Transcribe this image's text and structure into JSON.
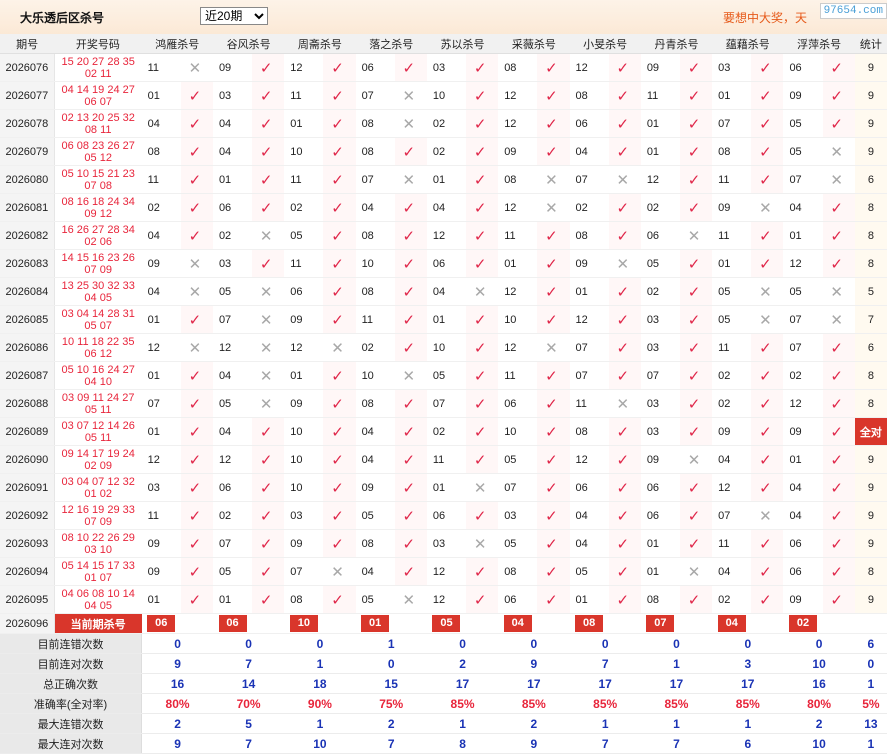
{
  "header": {
    "title": "大乐透后区杀号",
    "period_option": "近20期",
    "marquee": "要想中大奖，天",
    "logo": "97654.com"
  },
  "columns": {
    "period": "期号",
    "numbers": "开奖号码",
    "experts": [
      "鸿雁杀号",
      "谷风杀号",
      "周斋杀号",
      "落之杀号",
      "苏以杀号",
      "采薇杀号",
      "小旻杀号",
      "丹青杀号",
      "蕴藉杀号",
      "浮萍杀号"
    ],
    "stat": "统计"
  },
  "marks": {
    "ok": "✓",
    "err": "✕"
  },
  "rows": [
    {
      "qi": "2026076",
      "front": "15 20 27 28 35",
      "back": "02 11",
      "picks": [
        "11",
        "09",
        "12",
        "06",
        "03",
        "08",
        "12",
        "09",
        "03",
        "06"
      ],
      "res": [
        0,
        1,
        1,
        1,
        1,
        1,
        1,
        1,
        1,
        1
      ],
      "stat": "9"
    },
    {
      "qi": "2026077",
      "front": "04 14 19 24 27",
      "back": "06 07",
      "picks": [
        "01",
        "03",
        "11",
        "07",
        "10",
        "12",
        "08",
        "11",
        "01",
        "09"
      ],
      "res": [
        1,
        1,
        1,
        0,
        1,
        1,
        1,
        1,
        1,
        1
      ],
      "stat": "9"
    },
    {
      "qi": "2026078",
      "front": "02 13 20 25 32",
      "back": "08 11",
      "picks": [
        "04",
        "04",
        "01",
        "08",
        "02",
        "12",
        "06",
        "01",
        "07",
        "05"
      ],
      "res": [
        1,
        1,
        1,
        0,
        1,
        1,
        1,
        1,
        1,
        1
      ],
      "stat": "9"
    },
    {
      "qi": "2026079",
      "front": "06 08 23 26 27",
      "back": "05 12",
      "picks": [
        "08",
        "04",
        "10",
        "08",
        "02",
        "09",
        "04",
        "01",
        "08",
        "05"
      ],
      "res": [
        1,
        1,
        1,
        1,
        1,
        1,
        1,
        1,
        1,
        0
      ],
      "stat": "9"
    },
    {
      "qi": "2026080",
      "front": "05 10 15 21 23",
      "back": "07 08",
      "picks": [
        "11",
        "01",
        "11",
        "07",
        "01",
        "08",
        "07",
        "12",
        "11",
        "07"
      ],
      "res": [
        1,
        1,
        1,
        0,
        1,
        0,
        0,
        1,
        1,
        0
      ],
      "stat": "6"
    },
    {
      "qi": "2026081",
      "front": "08 16 18 24 34",
      "back": "09 12",
      "picks": [
        "02",
        "06",
        "02",
        "04",
        "04",
        "12",
        "02",
        "02",
        "09",
        "04"
      ],
      "res": [
        1,
        1,
        1,
        1,
        1,
        0,
        1,
        1,
        0,
        1
      ],
      "stat": "8"
    },
    {
      "qi": "2026082",
      "front": "16 26 27 28 34",
      "back": "02 06",
      "picks": [
        "04",
        "02",
        "05",
        "08",
        "12",
        "11",
        "08",
        "06",
        "11",
        "01"
      ],
      "res": [
        1,
        0,
        1,
        1,
        1,
        1,
        1,
        0,
        1,
        1
      ],
      "stat": "8"
    },
    {
      "qi": "2026083",
      "front": "14 15 16 23 26",
      "back": "07 09",
      "picks": [
        "09",
        "03",
        "11",
        "10",
        "06",
        "01",
        "09",
        "05",
        "01",
        "12"
      ],
      "res": [
        0,
        1,
        1,
        1,
        1,
        1,
        0,
        1,
        1,
        1
      ],
      "stat": "8"
    },
    {
      "qi": "2026084",
      "front": "13 25 30 32 33",
      "back": "04 05",
      "picks": [
        "04",
        "05",
        "06",
        "08",
        "04",
        "12",
        "01",
        "02",
        "05",
        "05"
      ],
      "res": [
        0,
        0,
        1,
        1,
        0,
        1,
        1,
        1,
        0,
        0
      ],
      "stat": "5"
    },
    {
      "qi": "2026085",
      "front": "03 04 14 28 31",
      "back": "05 07",
      "picks": [
        "01",
        "07",
        "09",
        "11",
        "01",
        "10",
        "12",
        "03",
        "05",
        "07"
      ],
      "res": [
        1,
        0,
        1,
        1,
        1,
        1,
        1,
        1,
        0,
        0
      ],
      "stat": "7"
    },
    {
      "qi": "2026086",
      "front": "10 11 18 22 35",
      "back": "06 12",
      "picks": [
        "12",
        "12",
        "12",
        "02",
        "10",
        "12",
        "07",
        "03",
        "11",
        "07"
      ],
      "res": [
        0,
        0,
        0,
        1,
        1,
        0,
        1,
        1,
        1,
        1
      ],
      "stat": "6"
    },
    {
      "qi": "2026087",
      "front": "05 10 16 24 27",
      "back": "04 10",
      "picks": [
        "01",
        "04",
        "01",
        "10",
        "05",
        "11",
        "07",
        "07",
        "02",
        "02"
      ],
      "res": [
        1,
        0,
        1,
        0,
        1,
        1,
        1,
        1,
        1,
        1
      ],
      "stat": "8"
    },
    {
      "qi": "2026088",
      "front": "03 09 11 24 27",
      "back": "05 11",
      "picks": [
        "07",
        "05",
        "09",
        "08",
        "07",
        "06",
        "11",
        "03",
        "02",
        "12"
      ],
      "res": [
        1,
        0,
        1,
        1,
        1,
        1,
        0,
        1,
        1,
        1
      ],
      "stat": "8"
    },
    {
      "qi": "2026089",
      "front": "03 07 12 14 26",
      "back": "05 11",
      "picks": [
        "01",
        "04",
        "10",
        "04",
        "02",
        "10",
        "08",
        "03",
        "09",
        "09"
      ],
      "res": [
        1,
        1,
        1,
        1,
        1,
        1,
        1,
        1,
        1,
        1
      ],
      "stat": "全对"
    },
    {
      "qi": "2026090",
      "front": "09 14 17 19 24",
      "back": "02 09",
      "picks": [
        "12",
        "12",
        "10",
        "04",
        "11",
        "05",
        "12",
        "09",
        "04",
        "01"
      ],
      "res": [
        1,
        1,
        1,
        1,
        1,
        1,
        1,
        0,
        1,
        1
      ],
      "stat": "9"
    },
    {
      "qi": "2026091",
      "front": "03 04 07 12 32",
      "back": "01 02",
      "picks": [
        "03",
        "06",
        "10",
        "09",
        "01",
        "07",
        "06",
        "06",
        "12",
        "04"
      ],
      "res": [
        1,
        1,
        1,
        1,
        0,
        1,
        1,
        1,
        1,
        1
      ],
      "stat": "9"
    },
    {
      "qi": "2026092",
      "front": "12 16 19 29 33",
      "back": "07 09",
      "picks": [
        "11",
        "02",
        "03",
        "05",
        "06",
        "03",
        "04",
        "06",
        "07",
        "04"
      ],
      "res": [
        1,
        1,
        1,
        1,
        1,
        1,
        1,
        1,
        0,
        1
      ],
      "stat": "9"
    },
    {
      "qi": "2026093",
      "front": "08 10 22 26 29",
      "back": "03 10",
      "picks": [
        "09",
        "07",
        "09",
        "08",
        "03",
        "05",
        "04",
        "01",
        "11",
        "06"
      ],
      "res": [
        1,
        1,
        1,
        1,
        0,
        1,
        1,
        1,
        1,
        1
      ],
      "stat": "9"
    },
    {
      "qi": "2026094",
      "front": "05 14 15 17 33",
      "back": "01 07",
      "picks": [
        "09",
        "05",
        "07",
        "04",
        "12",
        "08",
        "05",
        "01",
        "04",
        "06"
      ],
      "res": [
        1,
        1,
        0,
        1,
        1,
        1,
        1,
        0,
        1,
        1
      ],
      "stat": "8"
    },
    {
      "qi": "2026095",
      "front": "04 06 08 10 14",
      "back": "04 05",
      "picks": [
        "01",
        "01",
        "08",
        "05",
        "12",
        "06",
        "01",
        "08",
        "02",
        "09"
      ],
      "res": [
        1,
        1,
        1,
        0,
        1,
        1,
        1,
        1,
        1,
        1
      ],
      "stat": "9"
    }
  ],
  "current": {
    "qi": "2026096",
    "label": "当前期杀号",
    "picks": [
      "06",
      "06",
      "10",
      "01",
      "05",
      "04",
      "08",
      "07",
      "04",
      "02"
    ]
  },
  "summary": [
    {
      "label": "目前连错次数",
      "values": [
        "0",
        "0",
        "0",
        "1",
        "0",
        "0",
        "0",
        "0",
        "0",
        "0"
      ],
      "stat": "6"
    },
    {
      "label": "目前连对次数",
      "values": [
        "9",
        "7",
        "1",
        "0",
        "2",
        "9",
        "7",
        "1",
        "3",
        "10"
      ],
      "stat": "0"
    },
    {
      "label": "总正确次数",
      "values": [
        "16",
        "14",
        "18",
        "15",
        "17",
        "17",
        "17",
        "17",
        "17",
        "16"
      ],
      "stat": "1"
    },
    {
      "label": "准确率(全对率)",
      "values": [
        "80%",
        "70%",
        "90%",
        "75%",
        "85%",
        "85%",
        "85%",
        "85%",
        "85%",
        "80%"
      ],
      "stat": "5%",
      "red": true
    },
    {
      "label": "最大连错次数",
      "values": [
        "2",
        "5",
        "1",
        "2",
        "1",
        "2",
        "1",
        "1",
        "1",
        "2"
      ],
      "stat": "13"
    },
    {
      "label": "最大连对次数",
      "values": [
        "9",
        "7",
        "10",
        "7",
        "8",
        "9",
        "7",
        "7",
        "6",
        "10"
      ],
      "stat": "1"
    }
  ]
}
